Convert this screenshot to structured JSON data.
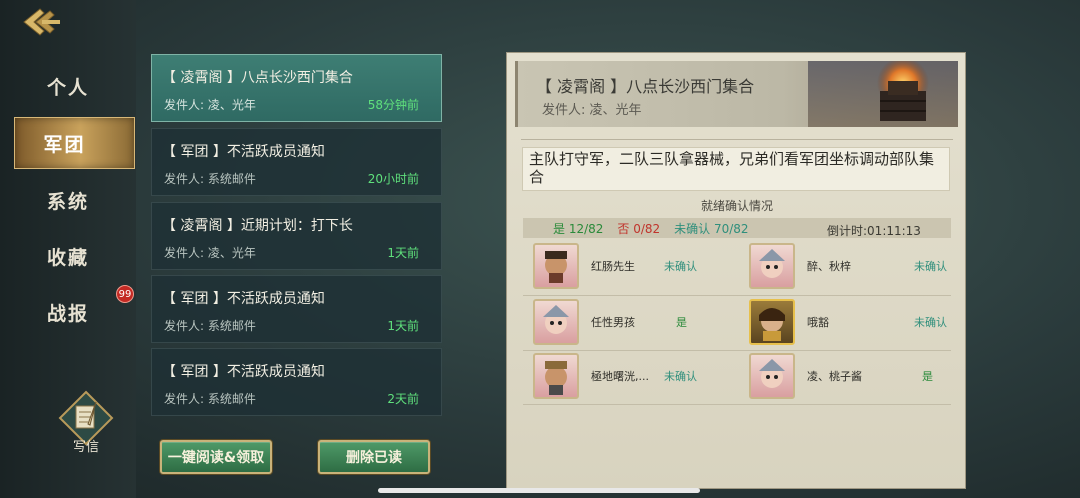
{
  "sidebar": {
    "items": [
      {
        "label": "个人"
      },
      {
        "label": "军团"
      },
      {
        "label": "系统"
      },
      {
        "label": "收藏"
      },
      {
        "label": "战报"
      }
    ],
    "badge_count": "99",
    "write_label": "写信"
  },
  "mails": [
    {
      "title": "【 凌霄阁 】八点长沙西门集合",
      "sender": "发件人: 凌、光年",
      "time": "58分钟前"
    },
    {
      "title": "【 军团 】不活跃成员通知",
      "sender": "发件人: 系统邮件",
      "time": "20小时前"
    },
    {
      "title": "【 凌霄阁 】近期计划：打下长",
      "sender": "发件人: 凌、光年",
      "time": "1天前"
    },
    {
      "title": "【 军团 】不活跃成员通知",
      "sender": "发件人: 系统邮件",
      "time": "1天前"
    },
    {
      "title": "【 军团 】不活跃成员通知",
      "sender": "发件人: 系统邮件",
      "time": "2天前"
    }
  ],
  "buttons": {
    "read_all": "一键阅读&领取",
    "delete_read": "删除已读"
  },
  "detail": {
    "title": "【 凌霄阁 】八点长沙西门集合",
    "sender": "发件人: 凌、光年",
    "content": "主队打守军，二队三队拿器械，兄弟们看军团坐标调动部队集合",
    "confirm_title": "就绪确认情况",
    "stats": {
      "yes": "是 12/82",
      "no": "否 0/82",
      "unconfirmed": "未确认 70/82",
      "countdown": "倒计时:01:11:13"
    },
    "members": [
      {
        "name": "红肠先生",
        "status": "未确认"
      },
      {
        "name": "醉、秋梓",
        "status": "未确认"
      },
      {
        "name": "任性男孩",
        "status": "是"
      },
      {
        "name": "哦豁",
        "status": "未确认"
      },
      {
        "name": "極地曙洸,...",
        "status": "未确认"
      },
      {
        "name": "凌、桃子酱",
        "status": "是"
      }
    ]
  },
  "colors": {
    "accent_green": "#5fe07c",
    "active_card": "#3e7e74",
    "badge_red": "#c42a24"
  }
}
